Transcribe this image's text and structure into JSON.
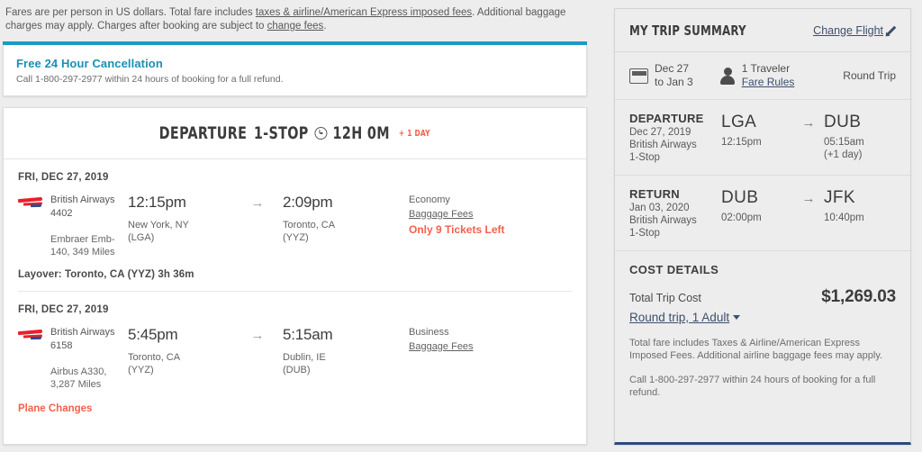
{
  "fare_notice": {
    "part1": "Fares are per person in US dollars. Total fare includes ",
    "link1": "taxes & airline/American Express imposed fees",
    "part2": ". Additional baggage charges may apply. Charges after booking are subject to ",
    "link2": "change fees",
    "part3": "."
  },
  "cancellation": {
    "title": "Free 24 Hour Cancellation",
    "subtitle": "Call 1-800-297-2977 within 24 hours of booking for a full refund."
  },
  "itinerary": {
    "header": {
      "direction": "DEPARTURE",
      "stops": "1-STOP",
      "duration": "12H 0M",
      "day_offset": "+ 1 DAY"
    },
    "segments": [
      {
        "date": "FRI, DEC 27, 2019",
        "airline": "British Airways",
        "flight_number": "4402",
        "equipment": "Embraer Emb-140, 349 Miles",
        "depart_time": "12:15pm",
        "depart_city": "New York, NY",
        "depart_code": "(LGA)",
        "arrive_time": "2:09pm",
        "arrive_city": "Toronto, CA",
        "arrive_code": "(YYZ)",
        "arrow": "→",
        "cabin": "Economy",
        "baggage_link": "Baggage Fees",
        "seats_warning": "Only 9 Tickets Left",
        "layover": "Layover: Toronto, CA (YYZ) 3h 36m"
      },
      {
        "date": "FRI, DEC 27, 2019",
        "airline": "British Airways",
        "flight_number": "6158",
        "equipment": "Airbus A330, 3,287 Miles",
        "depart_time": "5:45pm",
        "depart_city": "Toronto, CA",
        "depart_code": "(YYZ)",
        "arrive_time": "5:15am",
        "arrive_city": "Dublin, IE",
        "arrive_code": "(DUB)",
        "arrow": "→",
        "cabin": "Business",
        "baggage_link": "Baggage Fees",
        "seats_warning": "",
        "plane_changes": "Plane Changes"
      }
    ]
  },
  "sidebar": {
    "title": "MY TRIP SUMMARY",
    "change_flight": "Change Flight",
    "meta": {
      "date_line1": "Dec 27",
      "date_line2": "to Jan 3",
      "travelers": "1 Traveler",
      "fare_rules": "Fare Rules",
      "trip_type": "Round Trip"
    },
    "legs": [
      {
        "title": "DEPARTURE",
        "date": "Dec 27, 2019",
        "airline": "British Airways",
        "stops": "1-Stop",
        "origin_code": "LGA",
        "arrow": "→",
        "dest_code": "DUB",
        "depart_time": "12:15pm",
        "arrive_time": "05:15am",
        "arrive_day_offset": "(+1 day)"
      },
      {
        "title": "RETURN",
        "date": "Jan 03, 2020",
        "airline": "British Airways",
        "stops": "1-Stop",
        "origin_code": "DUB",
        "arrow": "→",
        "dest_code": "JFK",
        "depart_time": "02:00pm",
        "arrive_time": "10:40pm",
        "arrive_day_offset": ""
      }
    ],
    "cost": {
      "title": "COST DETAILS",
      "total_label": "Total Trip Cost",
      "total_amount": "$1,269.03",
      "selector": "Round trip, 1 Adult",
      "fine_print_1": "Total fare includes Taxes & Airline/American Express Imposed Fees. Additional airline baggage fees may apply.",
      "fine_print_2": "Call 1-800-297-2977 within 24 hours of booking for a full refund."
    }
  },
  "colors": {
    "accent_teal": "#1a9bc2",
    "warning_orange": "#f4604c",
    "link_navy": "#3d4f6b",
    "brand_red": "#e8202a",
    "sidebar_bottom": "#2b4b7e"
  }
}
